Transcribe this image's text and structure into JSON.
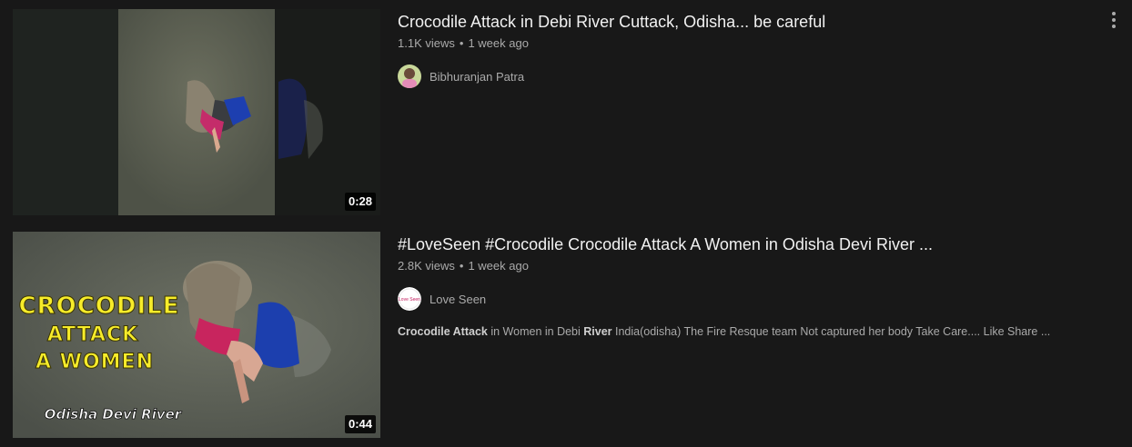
{
  "results": [
    {
      "title": "Crocodile Attack in Debi River Cuttack, Odisha... be careful",
      "views": "1.1K views",
      "age": "1 week ago",
      "channel": "Bibhuranjan Patra",
      "duration": "0:28"
    },
    {
      "title": "#LoveSeen #Crocodile Crocodile Attack A Women in Odisha Devi River ...",
      "views": "2.8K views",
      "age": "1 week ago",
      "channel": "Love Seen",
      "duration": "0:44",
      "avatar_text": "Love Seen",
      "description": {
        "b1": "Crocodile Attack",
        "t1": " in Women in Debi ",
        "b2": "River",
        "t2": " India(odisha) The Fire Resque team Not captured her body Take Care.... Like Share ..."
      },
      "thumb_overlay": {
        "line1": "CROCODILE",
        "line2": "ATTACK",
        "line3": "A WOMEN",
        "line4": "Odisha Devi River"
      }
    }
  ],
  "separator": "•",
  "colors": {
    "background": "#181818",
    "title": "#f1f1f1",
    "secondary": "#aaaaaa",
    "overlay_yellow": "#f7ec2a"
  }
}
